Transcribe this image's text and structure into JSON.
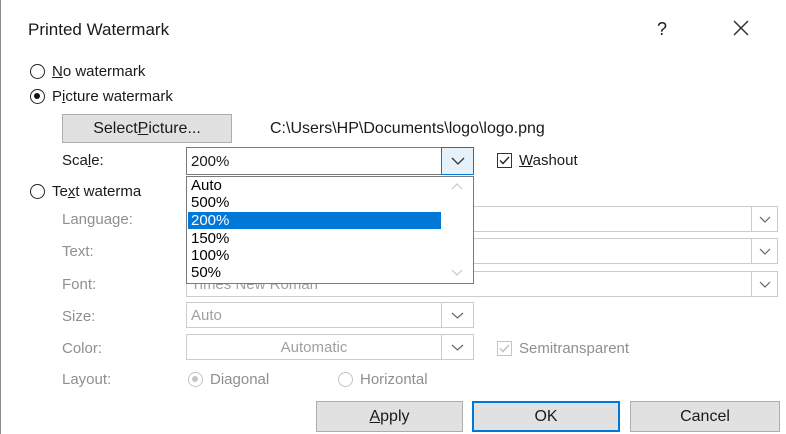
{
  "dialog": {
    "title": "Printed Watermark",
    "help_label": "?"
  },
  "options": {
    "no_watermark": {
      "label_prefix": "",
      "accel": "N",
      "label_rest": "o watermark",
      "checked": false
    },
    "picture_watermark": {
      "label_prefix": "P",
      "accel": "i",
      "label_rest": "cture watermark",
      "checked": true
    },
    "text_watermark": {
      "label_prefix": "Te",
      "accel": "x",
      "label_rest": "t waterma",
      "checked": false
    }
  },
  "picture": {
    "select_prefix": "Select ",
    "select_accel": "P",
    "select_rest": "icture...",
    "path": "C:\\Users\\HP\\Documents\\logo\\logo.png",
    "scale_prefix": "Sca",
    "scale_accel": "l",
    "scale_rest": "e:",
    "scale_value": "200%",
    "washout_accel": "W",
    "washout_rest": "ashout",
    "washout_checked": true
  },
  "scale_dropdown": {
    "items": [
      "Auto",
      "500%",
      "200%",
      "150%",
      "100%",
      "50%"
    ],
    "selected": "200%"
  },
  "text": {
    "language_label": "Language:",
    "text_label": "Text:",
    "font_label": "Font:",
    "font_value": "Times New Roman",
    "size_label": "Size:",
    "size_value": "Auto",
    "color_label": "Color:",
    "color_value": "Automatic",
    "semitransparent_label": "Semitransparent",
    "semitransparent_checked": true,
    "layout_label": "Layout:",
    "diagonal_label": "Diagonal",
    "horizontal_label": "Horizontal"
  },
  "buttons": {
    "apply_accel": "A",
    "apply_rest": "pply",
    "ok_label": "OK",
    "cancel_label": "Cancel"
  },
  "colors": {
    "accent": "#0078d7",
    "button_bg": "#e1e1e1",
    "disabled_text": "#a0a0a0"
  },
  "icons": {
    "close": "x-icon",
    "dropdown": "chevron-down-icon",
    "check": "checkmark-icon"
  }
}
